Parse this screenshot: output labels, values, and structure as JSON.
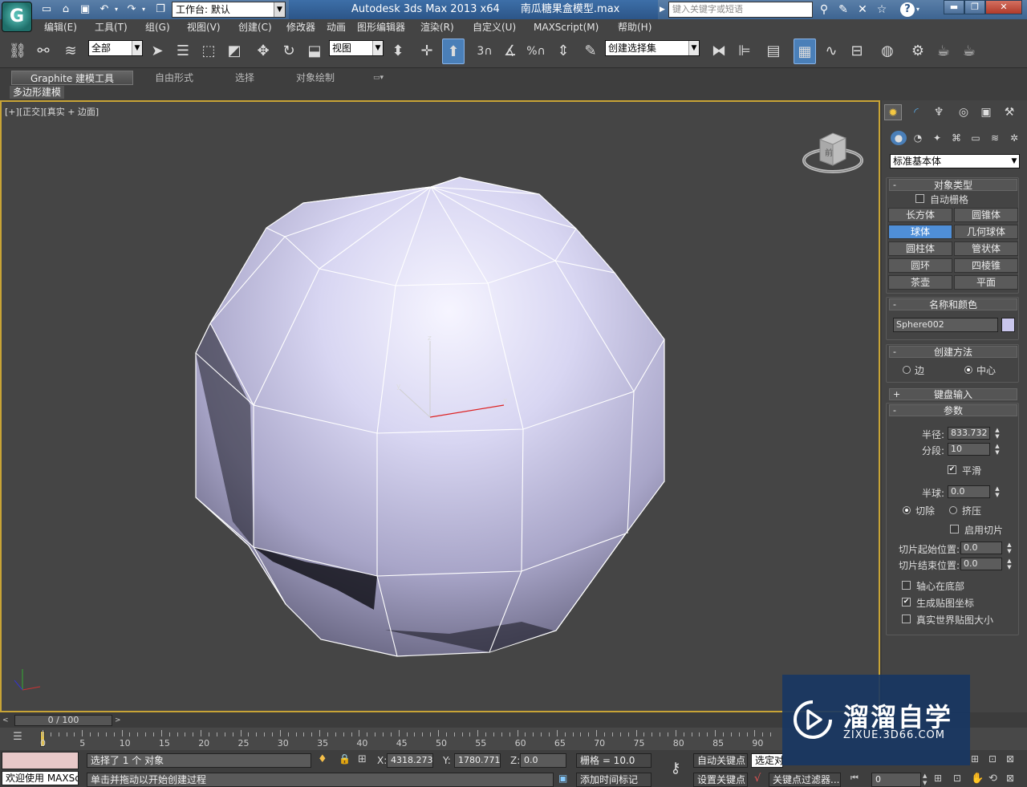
{
  "title_bar": {
    "app_title": "Autodesk 3ds Max  2013 x64",
    "file_name": "南瓜糖果盒模型.max",
    "workspace": "工作台: 默认",
    "search_placeholder": "键入关键字或短语"
  },
  "menus": [
    "编辑(E)",
    "工具(T)",
    "组(G)",
    "视图(V)",
    "创建(C)",
    "修改器",
    "动画",
    "图形编辑器",
    "渲染(R)",
    "自定义(U)",
    "MAXScript(M)",
    "帮助(H)"
  ],
  "toolbar": {
    "selection_filter": "全部",
    "ref_coord": "视图",
    "named_selection": "创建选择集",
    "snap_3": "3",
    "snap_angle_label": "%"
  },
  "ribbon": {
    "tabs": [
      "Graphite 建模工具",
      "自由形式",
      "选择",
      "对象绘制"
    ],
    "panel_label": "多边形建模"
  },
  "viewport": {
    "label_parts": [
      "[+]",
      "[正交]",
      "[真实 + 边面]"
    ],
    "viewcube_face": "前",
    "gizmo_axes": [
      "x",
      "y",
      "z"
    ]
  },
  "command_panel": {
    "category": "标准基本体",
    "object_type": {
      "title": "对象类型",
      "autogrid": "自动栅格",
      "buttons": [
        "长方体",
        "圆锥体",
        "球体",
        "几何球体",
        "圆柱体",
        "管状体",
        "圆环",
        "四棱锥",
        "茶壶",
        "平面"
      ],
      "active": "球体"
    },
    "name_color": {
      "title": "名称和颜色",
      "name": "Sphere002",
      "color": "#c9c6ec"
    },
    "creation_method": {
      "title": "创建方法",
      "edge": "边",
      "center": "中心"
    },
    "keyboard_entry": {
      "title": "键盘输入"
    },
    "parameters": {
      "title": "参数",
      "radius_label": "半径:",
      "radius": "833.732",
      "segments_label": "分段:",
      "segments": "10",
      "smooth": "平滑",
      "hemisphere_label": "半球:",
      "hemisphere": "0.0",
      "chop": "切除",
      "squash": "挤压",
      "enable_slice": "启用切片",
      "slice_from_label": "切片起始位置:",
      "slice_from": "0.0",
      "slice_to_label": "切片结束位置:",
      "slice_to": "0.0",
      "base_to_pivot": "轴心在底部",
      "gen_map_coords": "生成贴图坐标",
      "real_world_map": "真实世界贴图大小"
    }
  },
  "timeline": {
    "frame_display": "0 / 100",
    "ticks": [
      "0",
      "5",
      "10",
      "15",
      "20",
      "25",
      "30",
      "35",
      "40",
      "45",
      "50",
      "55",
      "60",
      "65",
      "70",
      "75",
      "80",
      "85",
      "90"
    ]
  },
  "status": {
    "maxscript_welcome": "欢迎使用 MAXSc",
    "selection_info": "选择了 1 个 对象",
    "prompt": "单击并拖动以开始创建过程",
    "x_label": "X:",
    "x": "4318.273",
    "y_label": "Y:",
    "y": "1780.771",
    "z_label": "Z:",
    "z": "0.0",
    "grid": "栅格 = 10.0",
    "add_time_tag": "添加时间标记",
    "auto_key": "自动关键点",
    "set_key": "设置关键点",
    "selected_dropdown": "选定对",
    "key_filters": "关键点过滤器...",
    "frame_field": "0"
  },
  "watermark": {
    "brand": "溜溜自学",
    "url": "ZIXUE.3D66.COM"
  }
}
